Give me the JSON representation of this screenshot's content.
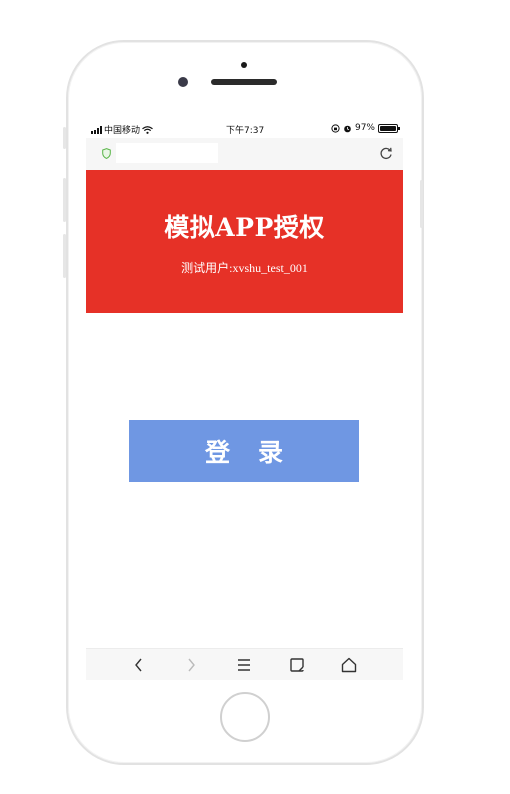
{
  "status_bar": {
    "carrier": "中国移动",
    "time": "下午7:37",
    "battery_text": "97%",
    "battery_level": 0.97
  },
  "browser": {
    "secure_icon": "shield-icon",
    "reload_icon": "reload-icon"
  },
  "banner": {
    "title": "模拟APP授权",
    "subtitle": "测试用户:xvshu_test_001",
    "color": "#e63127"
  },
  "login_button": {
    "label": "登录",
    "color": "#6f97e3"
  },
  "toolbar": {
    "items": [
      "back-icon",
      "forward-icon",
      "menu-icon",
      "tabs-icon",
      "home-icon"
    ]
  }
}
